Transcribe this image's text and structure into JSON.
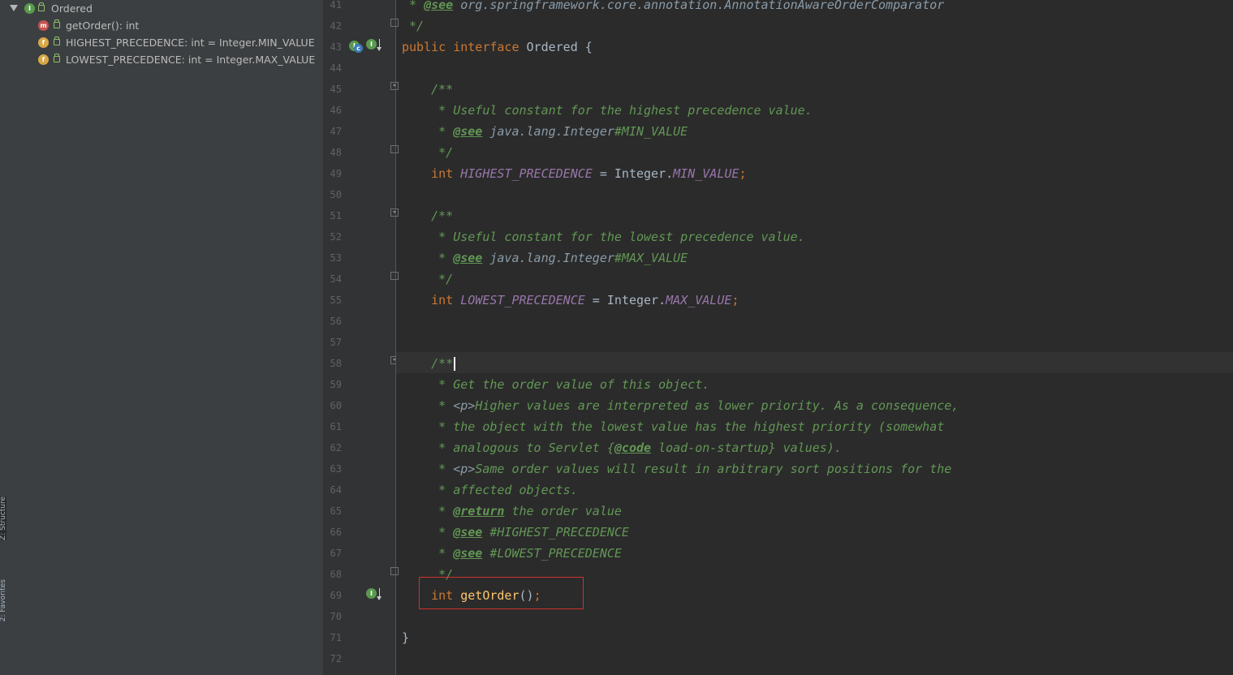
{
  "structure": {
    "root": {
      "name": "Ordered",
      "icon": "I"
    },
    "members": [
      {
        "label": "getOrder(): int",
        "icon": "m",
        "kind": "method"
      },
      {
        "label": "HIGHEST_PRECEDENCE: int = Integer.MIN_VALUE",
        "icon": "f",
        "kind": "field"
      },
      {
        "label": "LOWEST_PRECEDENCE: int = Integer.MAX_VALUE",
        "icon": "f",
        "kind": "field"
      }
    ]
  },
  "toolwindows": {
    "structure_label": "Z: Structure",
    "favorites_label": "2: Favorites"
  },
  "gutter": {
    "line_numbers": [
      "41",
      "42",
      "43",
      "44",
      "45",
      "46",
      "47",
      "48",
      "49",
      "50",
      "51",
      "52",
      "53",
      "54",
      "55",
      "56",
      "57",
      "58",
      "59",
      "60",
      "61",
      "62",
      "63",
      "64",
      "65",
      "66",
      "67",
      "68",
      "69",
      "70",
      "71",
      "72"
    ]
  },
  "code": {
    "l41_see_tag": "@see",
    "l41_ref": " org.springframework.core.annotation.AnnotationAwareOrderComparator",
    "l42": " */",
    "l43_public": "public",
    "l43_interface": "interface",
    "l43_name": "Ordered",
    "l43_brace": " {",
    "l45": "/**",
    "l46": " * Useful constant for the highest precedence value.",
    "l47_star": " * ",
    "l47_see": "@see",
    "l47_ref": " java.lang.Integer",
    "l47_member": "#MIN_VALUE",
    "l48": " */",
    "l49_type": "int",
    "l49_field": "HIGHEST_PRECEDENCE",
    "l49_eq": " = Integer.",
    "l49_const": "MIN_VALUE",
    "l49_semi": ";",
    "l51": "/**",
    "l52": " * Useful constant for the lowest precedence value.",
    "l53_star": " * ",
    "l53_see": "@see",
    "l53_ref": " java.lang.Integer",
    "l53_member": "#MAX_VALUE",
    "l54": " */",
    "l55_type": "int",
    "l55_field": "LOWEST_PRECEDENCE",
    "l55_eq": " = Integer.",
    "l55_const": "MAX_VALUE",
    "l55_semi": ";",
    "l58": "/**",
    "l59": " * Get the order value of this object.",
    "l60_star": " * ",
    "l60_tag": "<p>",
    "l60_text": "Higher values are interpreted as lower priority. As a consequence,",
    "l61": " * the object with the lowest value has the highest priority (somewhat",
    "l62_pre": " * analogous to Servlet {",
    "l62_code": "@code",
    "l62_post": " load-on-startup} values).",
    "l63_star": " * ",
    "l63_tag": "<p>",
    "l63_text": "Same order values will result in arbitrary sort positions for the",
    "l64": " * affected objects.",
    "l65_star": " * ",
    "l65_return": "@return",
    "l65_text": " the order value",
    "l66_star": " * ",
    "l66_see": "@see",
    "l66_text": " #HIGHEST_PRECEDENCE",
    "l67_star": " * ",
    "l67_see": "@see",
    "l67_text": " #LOWEST_PRECEDENCE",
    "l68": " */",
    "l69_type": "int",
    "l69_method": "getOrder",
    "l69_paren": "()",
    "l69_semi": ";",
    "l71": "}"
  },
  "colors": {
    "editor_bg": "#2b2b2b",
    "keyword": "#cc7832",
    "javadoc": "#629755",
    "field": "#9876aa",
    "method": "#ffc66d",
    "highlight_box": "#d0312d"
  }
}
